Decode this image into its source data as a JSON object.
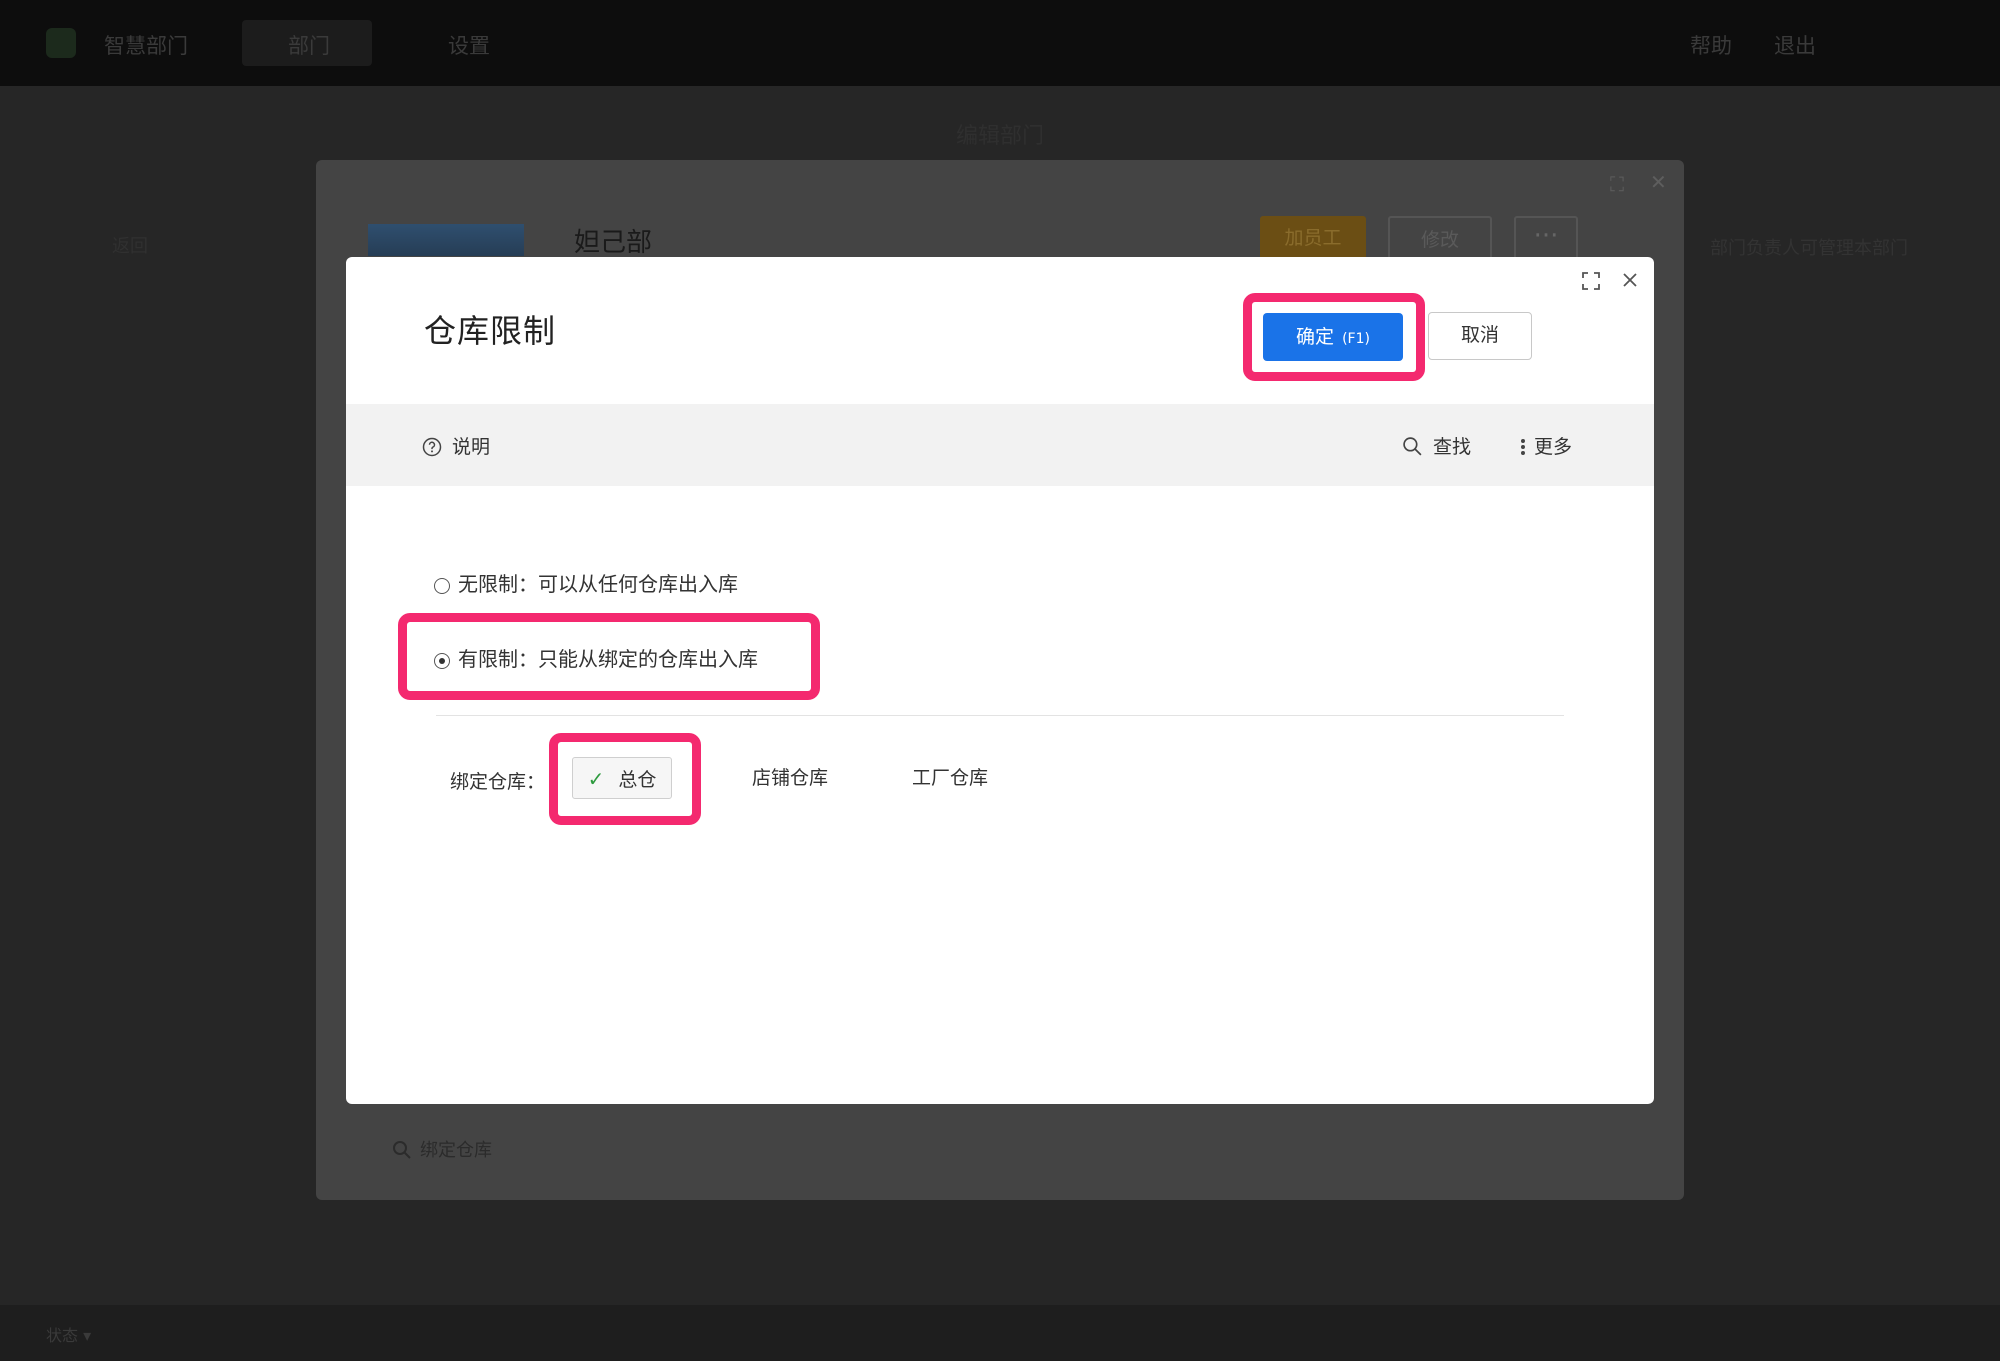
{
  "background_app": {
    "brand": "智慧部门",
    "tabs": [
      "部门",
      "设置"
    ],
    "header_right": [
      "帮助",
      "退出"
    ],
    "page_title": "编辑部门",
    "left_link": "返回",
    "right_note": "部门负责人可管理本部门",
    "bottom_status": "状态  ▾"
  },
  "outer_dialog": {
    "dept_name": "妲己部",
    "add_employee_label": "加员工",
    "edit_label": "修改",
    "more_label": "···",
    "search_placeholder": "绑定仓库"
  },
  "dialog": {
    "title": "仓库限制",
    "confirm_label": "确定",
    "confirm_shortcut": "(F1)",
    "cancel_label": "取消",
    "toolbar": {
      "help_label": "说明",
      "search_label": "查找",
      "more_label": "更多"
    },
    "options": [
      {
        "label": "无限制：可以从任何仓库出入库",
        "checked": false
      },
      {
        "label": "有限制：只能从绑定的仓库出入库",
        "checked": true
      }
    ],
    "bind_label": "绑定仓库：",
    "warehouses": [
      {
        "label": "总仓",
        "selected": true
      },
      {
        "label": "店铺仓库",
        "selected": false
      },
      {
        "label": "工厂仓库",
        "selected": false
      }
    ]
  },
  "colors": {
    "primary": "#1a73e8",
    "highlight": "#f4296f",
    "check": "#2e9b3f",
    "overlay": "#262626"
  },
  "icons": [
    "expand-icon",
    "close-icon",
    "help-circle-icon",
    "search-icon",
    "more-vertical-icon",
    "check-icon"
  ]
}
